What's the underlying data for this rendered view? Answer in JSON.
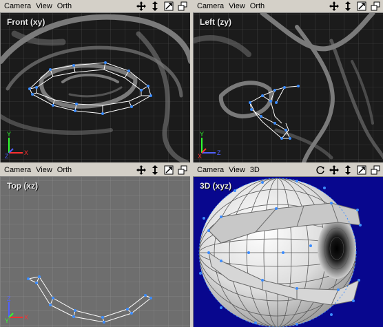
{
  "panes": [
    {
      "menu": [
        "Camera",
        "View",
        "Orth"
      ],
      "label": "Front (xy)",
      "style": "photo",
      "axes": {
        "up": "Y",
        "right": "X",
        "out": "Z"
      },
      "tools": [
        "move-icon",
        "pan-vertical-icon",
        "maximize-icon",
        "restore-icon"
      ]
    },
    {
      "menu": [
        "Camera",
        "View",
        "Orth"
      ],
      "label": "Left (zy)",
      "style": "photo",
      "axes": {
        "up": "Y",
        "right": "Z",
        "out": "X"
      },
      "tools": [
        "move-icon",
        "pan-vertical-icon",
        "maximize-icon",
        "restore-icon"
      ]
    },
    {
      "menu": [
        "Camera",
        "View",
        "Orth"
      ],
      "label": "Top (xz)",
      "style": "gray",
      "axes": {
        "up": "Z",
        "right": "X",
        "out": "Y"
      },
      "tools": [
        "move-icon",
        "pan-vertical-icon",
        "maximize-icon",
        "restore-icon"
      ]
    },
    {
      "menu": [
        "Camera",
        "View",
        "3D"
      ],
      "label": "3D (xyz)",
      "style": "blue",
      "axes": null,
      "tools": [
        "rotate-icon",
        "move-icon",
        "pan-vertical-icon",
        "maximize-icon",
        "restore-icon"
      ]
    }
  ],
  "colors": {
    "axis_x": "#ff3030",
    "axis_y": "#30ff30",
    "axis_z": "#5060ff",
    "vertex": "#3b8cff",
    "wire": "#ffffff",
    "grid": "#8a8a8a",
    "view3d_bg": "#08078e"
  }
}
